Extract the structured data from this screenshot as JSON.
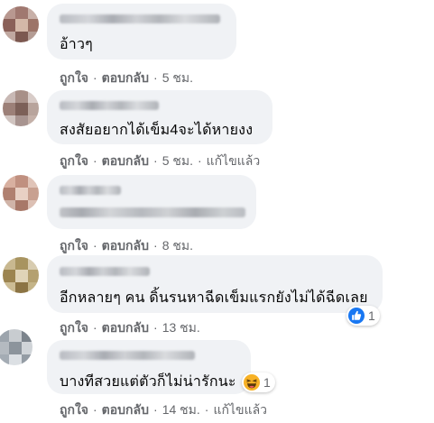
{
  "actions": {
    "like": "ถูกใจ",
    "reply": "ตอบกลับ",
    "sep": "·",
    "edited": "แก้ไขแล้ว"
  },
  "comments": [
    {
      "text": "อ้าวๆ",
      "time": "5 ชม."
    },
    {
      "text": "สงสัยอยากได้เข็ม4จะได้หายงง",
      "time": "5 ชม."
    },
    {
      "text": "",
      "time": "8 ชม."
    },
    {
      "text": "อีกหลายๆ คน ดิ้นรนหาฉีดเข็มแรกยังไม่ได้ฉีดเลย",
      "time": "13 ชม.",
      "reaction": {
        "icon": "like-reaction-icon",
        "count": "1"
      }
    },
    {
      "text": "บางทีสวยแต่ตัวก็ไม่น่ารักนะ",
      "time": "14 ชม.",
      "reaction": {
        "icon": "haha-reaction-icon",
        "count": "1"
      }
    }
  ],
  "colors": {
    "bubble": "#f0f2f5",
    "meta": "#65676b",
    "like_blue": "#1877f2",
    "haha_yellow": "#f7b125"
  }
}
